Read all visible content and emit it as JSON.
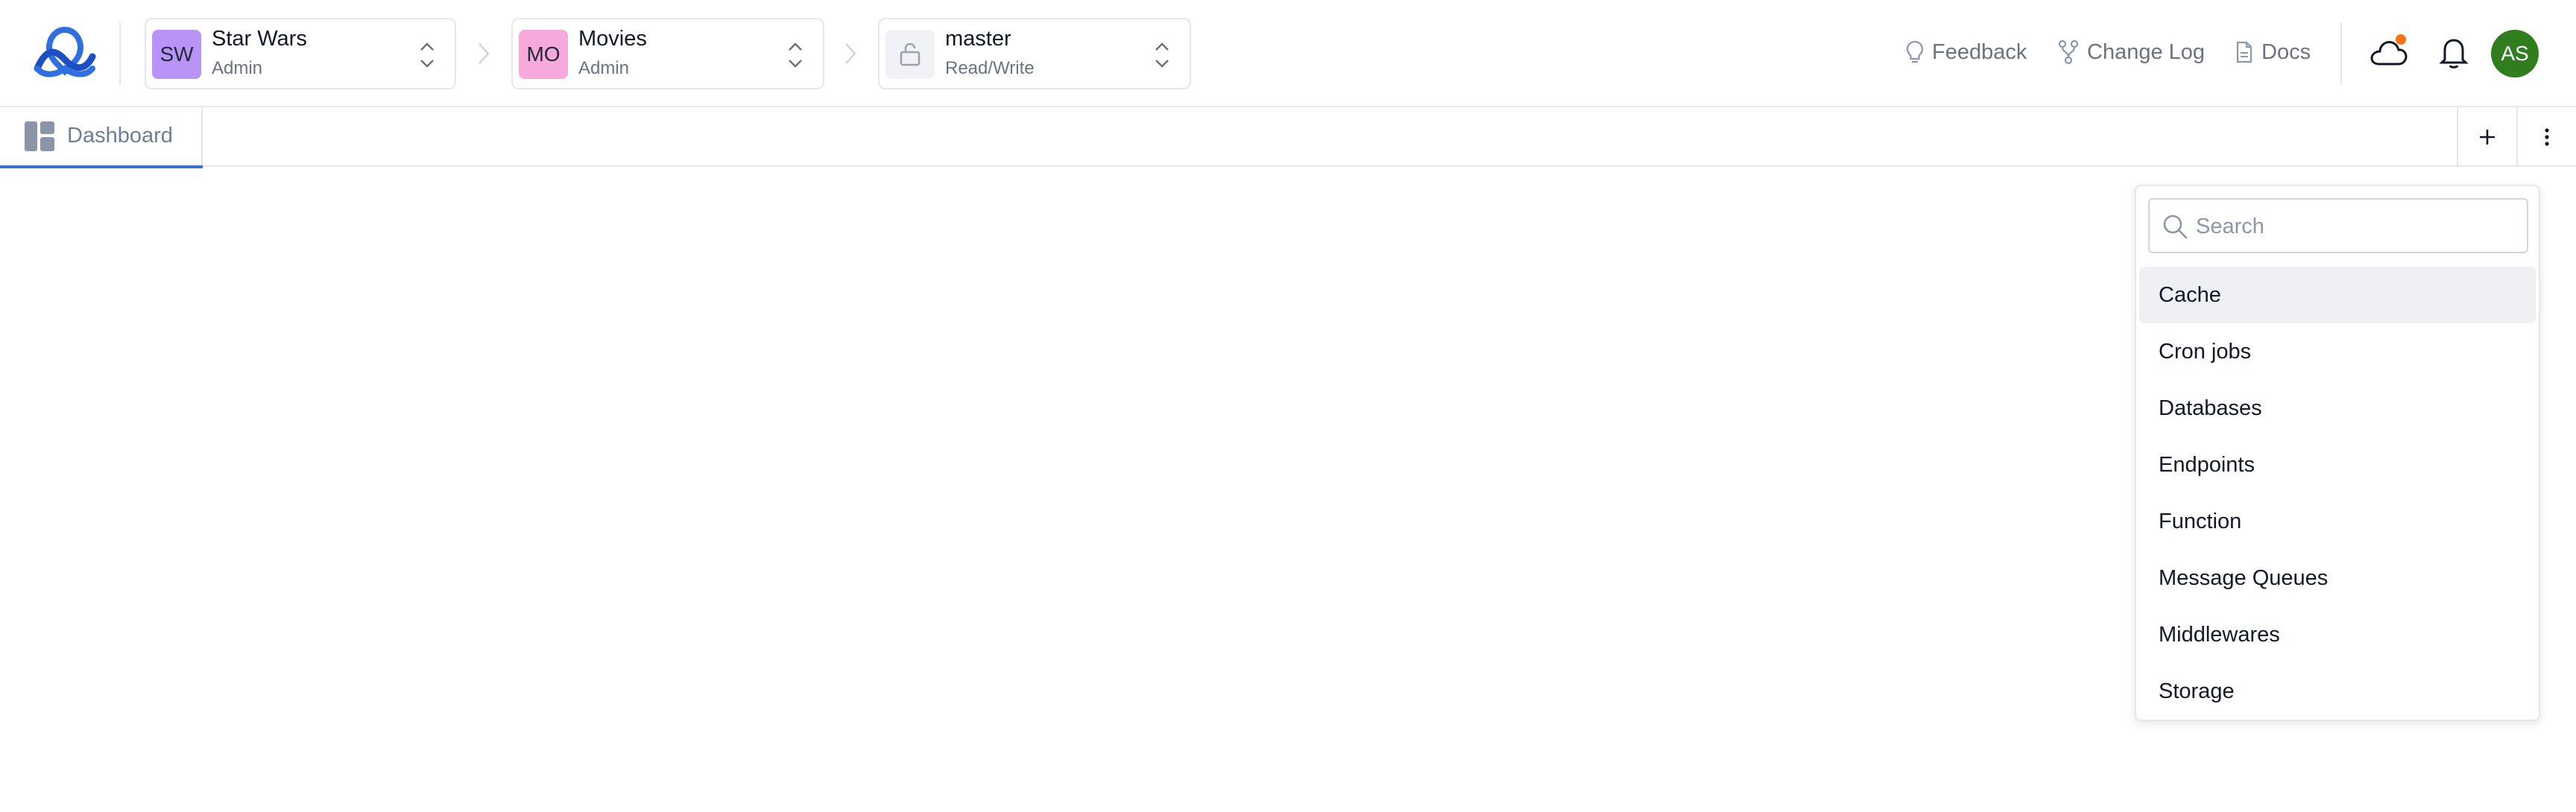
{
  "header": {
    "logo_name": "app-logo",
    "org": {
      "initials": "SW",
      "name": "Star Wars",
      "role": "Admin",
      "color": "#b794f6"
    },
    "project": {
      "initials": "MO",
      "name": "Movies",
      "role": "Admin",
      "color": "#f5a9dc"
    },
    "branch": {
      "icon": "lock-open-icon",
      "name": "master",
      "mode": "Read/Write"
    },
    "links": {
      "feedback": {
        "label": "Feedback",
        "icon": "lightbulb-icon"
      },
      "changelog": {
        "label": "Change Log",
        "icon": "git-branch-icon"
      },
      "docs": {
        "label": "Docs",
        "icon": "document-icon"
      }
    },
    "status_dot_color": "#f97316",
    "user": {
      "initials": "AS",
      "color": "#2f7d1d"
    }
  },
  "tabs": [
    {
      "label": "Dashboard",
      "icon": "dashboard-layout-icon",
      "active": true
    }
  ],
  "tab_actions": {
    "add_icon": "plus-icon",
    "more_icon": "vertical-ellipsis-icon"
  },
  "dropdown": {
    "search_placeholder": "Search",
    "items": [
      "Cache",
      "Cron jobs",
      "Databases",
      "Endpoints",
      "Function",
      "Message Queues",
      "Middlewares",
      "Storage"
    ],
    "active_item": "Cache"
  },
  "colors": {
    "accent": "#3b6fd8",
    "border": "#e5e7eb",
    "muted_text": "#6b7280"
  }
}
